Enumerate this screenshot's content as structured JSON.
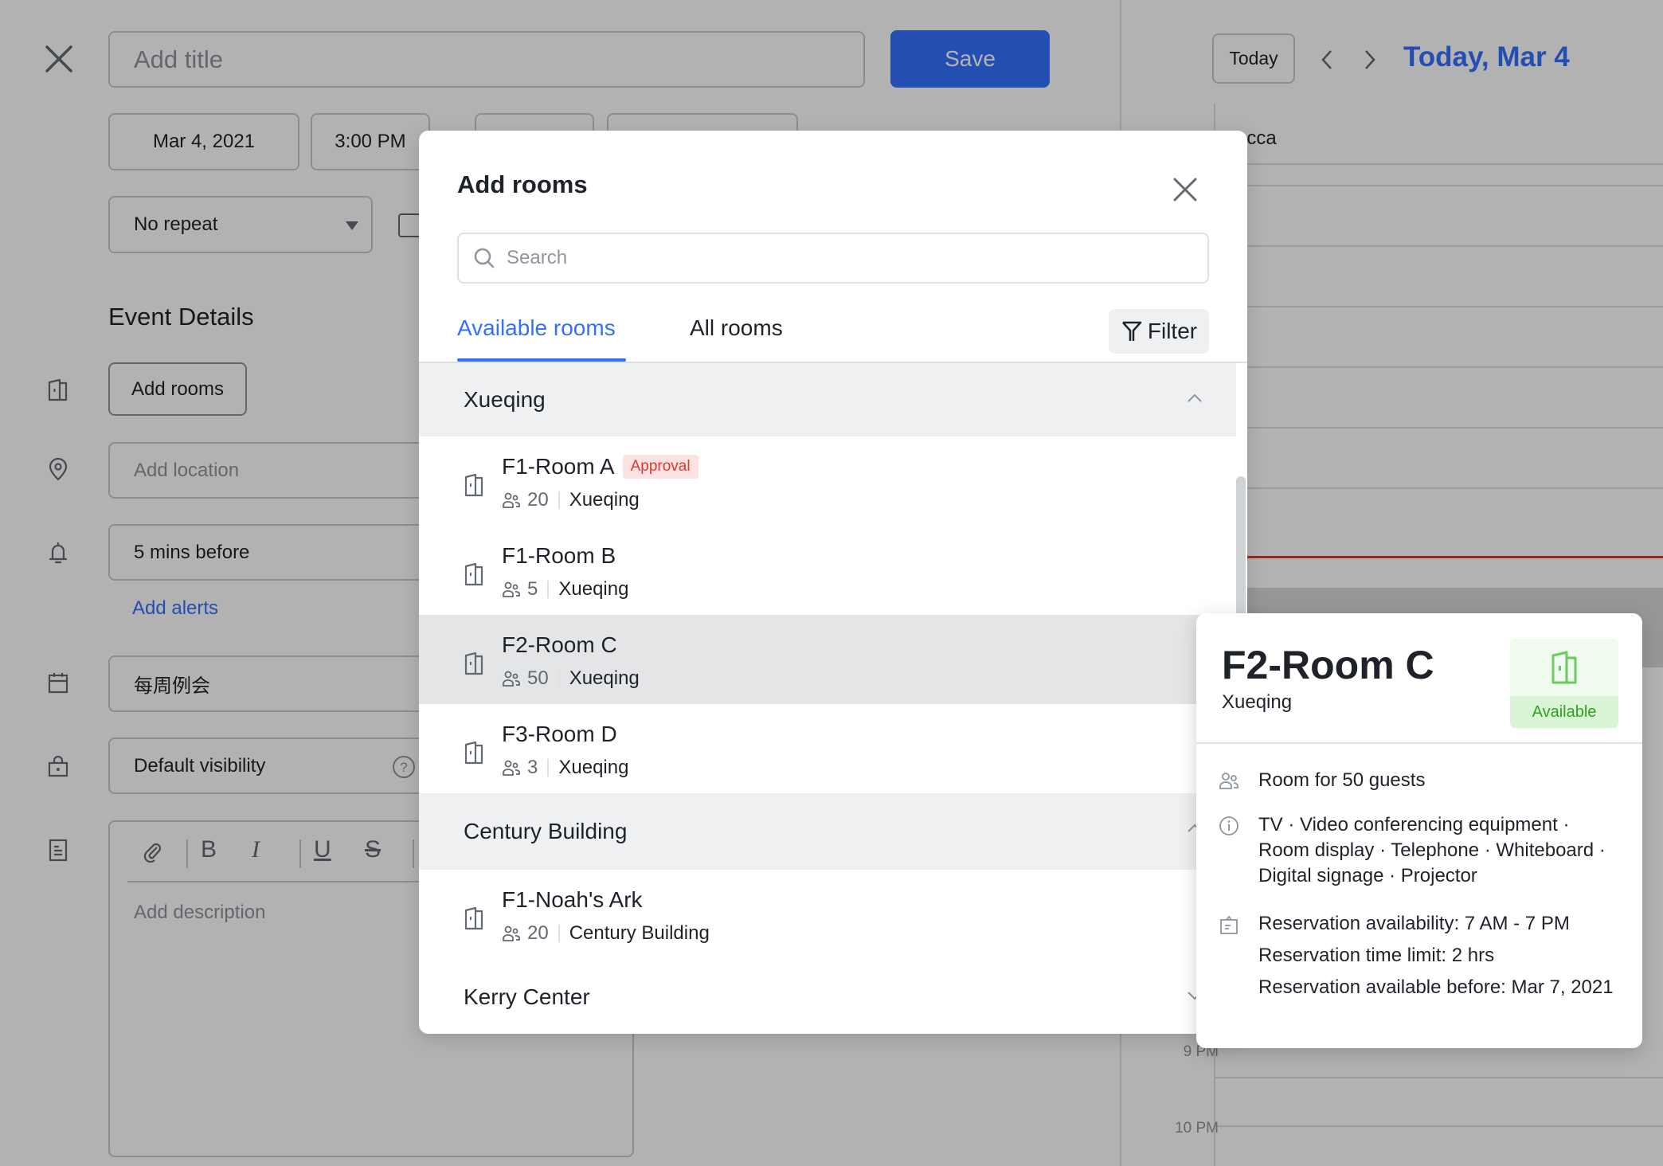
{
  "event_form": {
    "title_placeholder": "Add title",
    "save_label": "Save",
    "start_date": "Mar 4, 2021",
    "start_time": "3:00 PM",
    "repeat": "No repeat",
    "section_title": "Event Details",
    "add_rooms_label": "Add rooms",
    "location_placeholder": "Add location",
    "alert_value": "5 mins before",
    "add_alerts_label": "Add alerts",
    "calendar_value": "每周例会",
    "visibility_value": "Default visibility",
    "description_placeholder": "Add description",
    "toolbar": [
      "attachment",
      "bold",
      "italic",
      "underline",
      "strikethrough"
    ]
  },
  "calendar": {
    "today_label": "Today",
    "current_date": "Today, Mar 4",
    "attendee_fragment": "ecca",
    "hour_labels": [
      "9 PM",
      "10 PM"
    ],
    "accent_color": "#3370ff",
    "now_line_color": "#d83931"
  },
  "modal": {
    "title": "Add rooms",
    "search_placeholder": "Search",
    "tabs": [
      {
        "label": "Available rooms",
        "active": true
      },
      {
        "label": "All rooms",
        "active": false
      }
    ],
    "filter_label": "Filter",
    "groups": [
      {
        "name": "Xueqing",
        "expanded": true,
        "rooms": [
          {
            "name": "F1-Room A",
            "badge": "Approval",
            "capacity": "20",
            "location": "Xueqing"
          },
          {
            "name": "F1-Room B",
            "badge": null,
            "capacity": "5",
            "location": "Xueqing"
          },
          {
            "name": "F2-Room C",
            "badge": null,
            "capacity": "50",
            "location": "Xueqing",
            "hovered": true
          },
          {
            "name": "F3-Room D",
            "badge": null,
            "capacity": "3",
            "location": "Xueqing"
          }
        ]
      },
      {
        "name": "Century Building",
        "expanded": true,
        "rooms": [
          {
            "name": "F1-Noah's Ark",
            "badge": null,
            "capacity": "20",
            "location": "Century Building"
          }
        ]
      },
      {
        "name": "Kerry Center",
        "expanded": false,
        "rooms": []
      }
    ]
  },
  "room_detail": {
    "name": "F2-Room C",
    "building": "Xueqing",
    "status": "Available",
    "status_color": "#2ea121",
    "capacity_text": "Room for 50 guests",
    "equipment_text": "TV · Video conferencing equipment · Room display · Telephone · Whiteboard · Digital signage · Projector",
    "reservation": [
      "Reservation availability: 7 AM - 7 PM",
      "Reservation time limit: 2 hrs",
      "Reservation available before: Mar 7, 2021"
    ]
  }
}
